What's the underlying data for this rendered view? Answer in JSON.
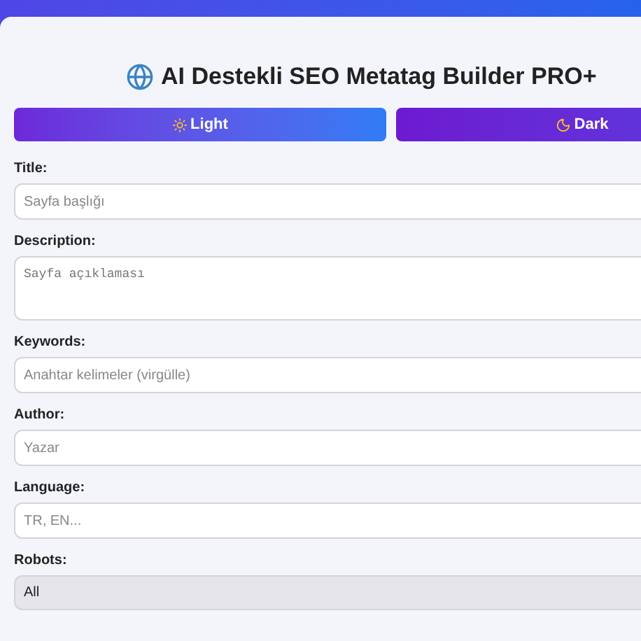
{
  "title": "AI Destekli SEO Metatag Builder PRO+",
  "theme_buttons": [
    {
      "label": "Light",
      "kind": "light"
    },
    {
      "label": "Dark",
      "kind": "dark"
    }
  ],
  "fields": [
    {
      "label": "Title:",
      "kind": "input",
      "placeholder": "Sayfa başlığı"
    },
    {
      "label": "Description:",
      "kind": "textarea",
      "placeholder": "Sayfa açıklaması"
    },
    {
      "label": "Keywords:",
      "kind": "input",
      "placeholder": "Anahtar kelimeler (virgülle)"
    },
    {
      "label": "Author:",
      "kind": "input",
      "placeholder": "Yazar"
    },
    {
      "label": "Language:",
      "kind": "input",
      "placeholder": "TR, EN..."
    },
    {
      "label": "Robots:",
      "kind": "select",
      "value": "All"
    }
  ]
}
